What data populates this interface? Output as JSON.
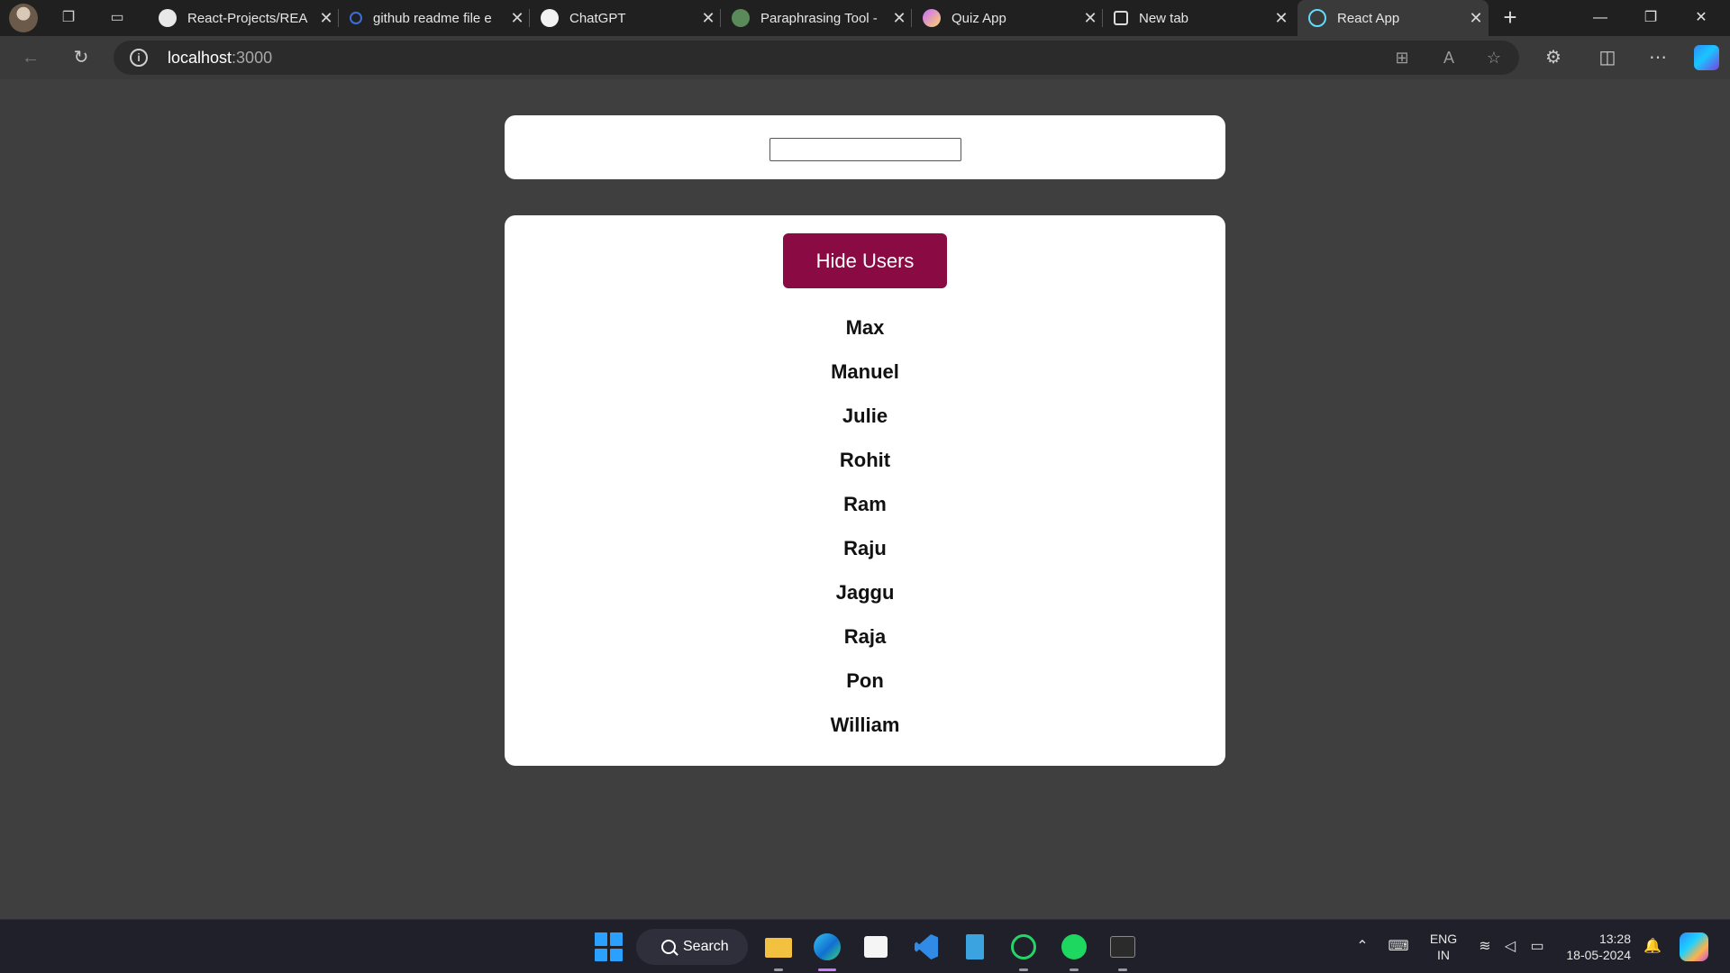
{
  "browser": {
    "tabs": [
      {
        "title": "React-Projects/REA",
        "icon": "github-icon",
        "active": false
      },
      {
        "title": "github readme file e",
        "icon": "search-icon",
        "active": false
      },
      {
        "title": "ChatGPT",
        "icon": "chatgpt-icon",
        "active": false
      },
      {
        "title": "Paraphrasing Tool -",
        "icon": "quillbot-icon",
        "active": false
      },
      {
        "title": "Quiz App",
        "icon": "quiz-app-icon",
        "active": false
      },
      {
        "title": "New tab",
        "icon": "new-tab-page-icon",
        "active": false
      },
      {
        "title": "React App",
        "icon": "react-icon",
        "active": true
      }
    ],
    "close_glyph": "✕",
    "address": {
      "host": "localhost",
      "port": ":3000"
    }
  },
  "app": {
    "search_value": "",
    "toggle_button_label": "Hide Users",
    "users": [
      "Max",
      "Manuel",
      "Julie",
      "Rohit",
      "Ram",
      "Raju",
      "Jaggu",
      "Raja",
      "Pon",
      "William"
    ],
    "colors": {
      "background": "#3f3f3f",
      "card": "#ffffff",
      "button": "#8a0a43"
    }
  },
  "taskbar": {
    "search_label": "Search",
    "language_line1": "ENG",
    "language_line2": "IN",
    "time": "13:28",
    "date": "18-05-2024"
  }
}
